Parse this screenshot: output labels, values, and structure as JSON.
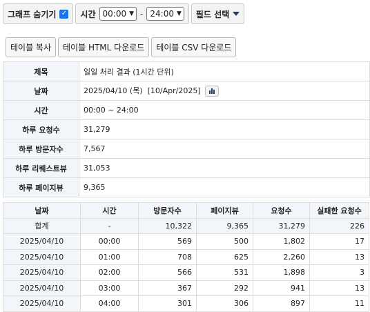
{
  "toolbar": {
    "hide_graph_label": "그래프 숨기기",
    "hide_graph_checked": true,
    "time_label": "시간",
    "time_from": "00:00",
    "time_sep": "-",
    "time_to": "24:00",
    "field_select_label": "필드 선택"
  },
  "buttons": {
    "copy": "테이블 복사",
    "html_download": "테이블 HTML 다운로드",
    "csv_download": "테이블 CSV 다운로드"
  },
  "info": [
    {
      "key": "제목",
      "value": "일일 처리 결과 (1시간 단위)"
    },
    {
      "key": "날짜",
      "value": "2025/04/10 (목)  [10/Apr/2025]"
    },
    {
      "key": "시간",
      "value": "00:00 ~ 24:00"
    },
    {
      "key": "하루 요청수",
      "value": "31,279"
    },
    {
      "key": "하루 방문자수",
      "value": "7,567"
    },
    {
      "key": "하루 리퀘스트뷰",
      "value": "31,053"
    },
    {
      "key": "하루 페이지뷰",
      "value": "9,365"
    }
  ],
  "table": {
    "headers": [
      "날짜",
      "시간",
      "방문자수",
      "페이지뷰",
      "요청수",
      "실패한 요청수"
    ],
    "rows": [
      [
        "합계",
        "-",
        "10,322",
        "9,365",
        "31,279",
        "226"
      ],
      [
        "2025/04/10",
        "00:00",
        "569",
        "500",
        "1,802",
        "17"
      ],
      [
        "2025/04/10",
        "01:00",
        "708",
        "625",
        "2,260",
        "13"
      ],
      [
        "2025/04/10",
        "02:00",
        "566",
        "531",
        "1,898",
        "3"
      ],
      [
        "2025/04/10",
        "03:00",
        "367",
        "292",
        "941",
        "13"
      ],
      [
        "2025/04/10",
        "04:00",
        "301",
        "306",
        "897",
        "11"
      ]
    ]
  },
  "colors": {
    "accent": "#1a73e8",
    "header_bg": "#f2f6fb",
    "border": "#dcdcdc"
  }
}
